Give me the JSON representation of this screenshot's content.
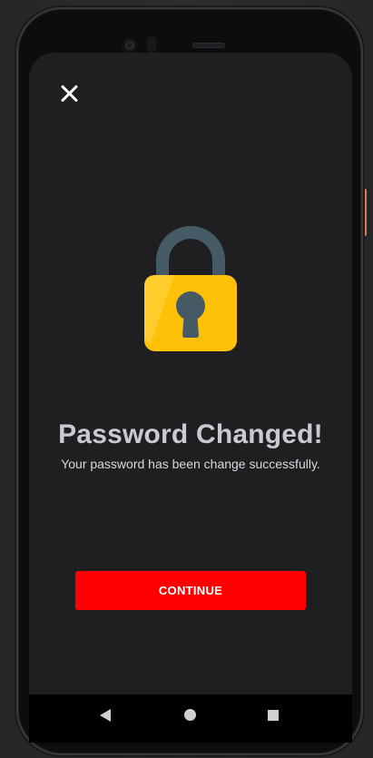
{
  "screen": {
    "title": "Password Changed!",
    "subtitle": "Your password has been change successfully.",
    "continue_label": "CONTINUE"
  },
  "icons": {
    "close": "close-icon",
    "lock": "lock-icon",
    "nav_back": "back-triangle-icon",
    "nav_home": "home-circle-icon",
    "nav_recents": "recents-square-icon"
  },
  "colors": {
    "background": "#1f1f22",
    "button": "#ff0000",
    "lock_body": "#ffc107",
    "lock_shackle": "#455a64"
  }
}
